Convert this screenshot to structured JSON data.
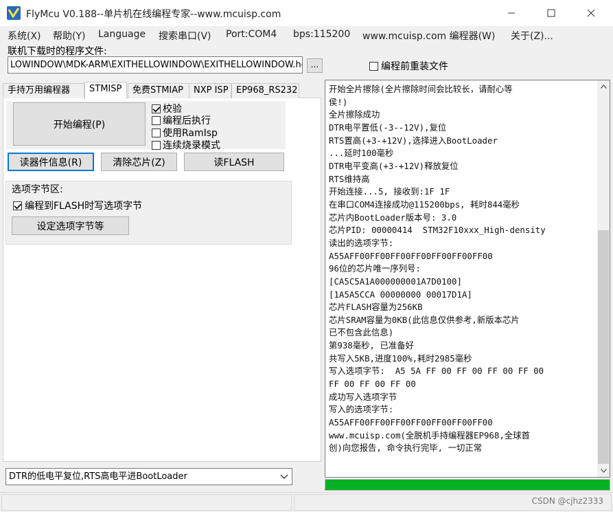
{
  "window": {
    "title": "FlyMcu V0.188--单片机在线编程专家--www.mcuisp.com",
    "icon": "flymcu-app-icon"
  },
  "menu": [
    "系统(X)",
    "帮助(Y)",
    "Language",
    "搜索串口(V)",
    "Port:COM4",
    "bps:115200",
    "www.mcuisp.com 编程器(W)",
    "关于(Z)..."
  ],
  "file": {
    "label": "联机下载时的程序文件:",
    "path": "LOWINDOW\\MDK-ARM\\EXITHELLOWINDOW\\EXITHELLOWINDOW.hex",
    "browse": "...",
    "reload_label": "编程前重装文件",
    "reload_checked": false
  },
  "tabs": [
    "手持万用编程器",
    "STMISP",
    "免费STMIAP",
    "NXP ISP",
    "EP968_RS232"
  ],
  "active_tab": "STMISP",
  "buttons": {
    "start": "开始编程(P)",
    "read_info": "读器件信息(R)",
    "erase": "清除芯片(Z)",
    "read_flash": "读FLASH",
    "set_options": "设定选项字节等"
  },
  "options": [
    {
      "label": "校验",
      "checked": true
    },
    {
      "label": "编程后执行",
      "checked": false
    },
    {
      "label": "使用RamIsp",
      "checked": false
    },
    {
      "label": "连续烧录模式",
      "checked": false
    }
  ],
  "option_bytes": {
    "title": "选项字节区:",
    "write_label": "编程到FLASH时写选项字节",
    "write_checked": true
  },
  "dtr_mode": "DTR的低电平复位,RTS高电平进BootLoader",
  "log_lines": [
    "开始全片擦除(全片擦除时间会比较长，请耐心等",
    "侯!)",
    "全片擦除成功",
    "DTR电平置低(-3--12V),复位",
    "RTS置高(+3-+12V),选择进入BootLoader",
    "...延时100毫秒",
    "DTR电平变高(+3-+12V)释放复位",
    "RTS维持高",
    "开始连接...5, 接收到:1F 1F",
    "在串口COM4连接成功@115200bps, 耗时844毫秒",
    "芯片内BootLoader版本号: 3.0",
    "芯片PID: 00000414  STM32F10xxx_High-density",
    "读出的选项字节:",
    "A55AFF00FF00FF00FF00FF00FF00FF00",
    "96位的芯片唯一序列号:",
    "[CA5C5A1A000000001A7D0100]",
    "[1A5A5CCA 00000000 00017D1A]",
    "芯片FLASH容量为256KB",
    "芯片SRAM容量为0KB(此信息仅供参考,新版本芯片",
    "已不包含此信息)",
    "第938毫秒, 已准备好",
    "共写入5KB,进度100%,耗时2985毫秒",
    "写入选项字节:  A5 5A FF 00 FF 00 FF 00 FF 00",
    "FF 00 FF 00 FF 00",
    "成功写入选项字节",
    "写入的选项字节:",
    "A55AFF00FF00FF00FF00FF00FF00FF00",
    "www.mcuisp.com(全脱机手持编程器EP968,全球首",
    "创)向您报告, 命令执行完毕, 一切正常"
  ],
  "progress_fraction": 1.0,
  "progress_color": "#06b025",
  "focus_color": "#0078d7",
  "watermark": "CSDN @cjhz2333"
}
